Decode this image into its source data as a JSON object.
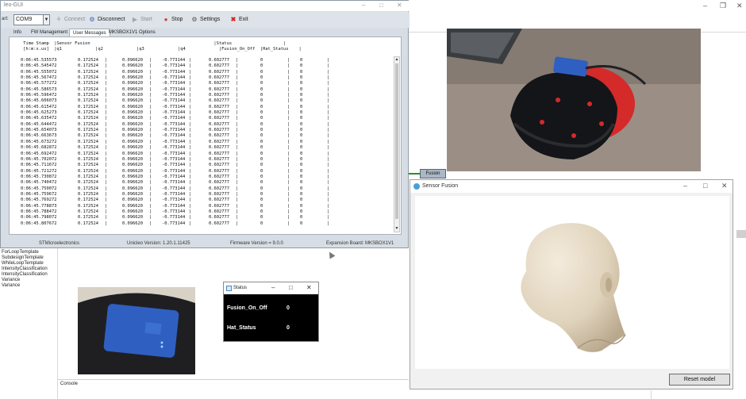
{
  "gui": {
    "title": "leo-GUI",
    "port_label": "art:",
    "port_value": "COM9",
    "toolbar": [
      {
        "label": "Connect",
        "icon": "plug-icon",
        "enabled": false
      },
      {
        "label": "Disconnect",
        "icon": "disconnect-icon",
        "enabled": true
      },
      {
        "label": "Start",
        "icon": "start-icon",
        "enabled": false
      },
      {
        "label": "Stop",
        "icon": "stop-icon",
        "enabled": true
      },
      {
        "label": "Settings",
        "icon": "gear-icon",
        "enabled": true
      },
      {
        "label": "Exit",
        "icon": "close-icon",
        "enabled": true
      }
    ],
    "tabs": [
      "Info",
      "FW Management",
      "User Messages",
      "MKSBOX1V1 Options"
    ],
    "active_tab": "User Messages",
    "table_header": " Time Stamp  |Sensor Fusion                                                |Status                    |\n [h:m:s.us]  |q1             |q2             |q3             |q4             |Fusion_On_Off  |Hat_Status    |",
    "rows": [
      [
        "0:06:45.535573",
        "0.172524",
        "0.096620",
        "-0.773144",
        "0.602777",
        "0",
        "0"
      ],
      [
        "0:06:45.545472",
        "0.172524",
        "0.096620",
        "-0.773144",
        "0.602777",
        "0",
        "0"
      ],
      [
        "0:06:45.555072",
        "0.172524",
        "0.096620",
        "-0.773144",
        "0.602777",
        "0",
        "0"
      ],
      [
        "0:06:45.567472",
        "0.172524",
        "0.096620",
        "-0.773144",
        "0.602777",
        "0",
        "0"
      ],
      [
        "0:06:45.577272",
        "0.172524",
        "0.096620",
        "-0.773144",
        "0.602777",
        "0",
        "0"
      ],
      [
        "0:06:45.586573",
        "0.172524",
        "0.096620",
        "-0.773144",
        "0.602777",
        "0",
        "0"
      ],
      [
        "0:06:45.596472",
        "0.172524",
        "0.096620",
        "-0.773144",
        "0.602777",
        "0",
        "0"
      ],
      [
        "0:06:45.606073",
        "0.172524",
        "0.096620",
        "-0.773144",
        "0.602777",
        "0",
        "0"
      ],
      [
        "0:06:45.615472",
        "0.172524",
        "0.096620",
        "-0.773144",
        "0.602777",
        "0",
        "0"
      ],
      [
        "0:06:45.625273",
        "0.172524",
        "0.096620",
        "-0.773144",
        "0.602777",
        "0",
        "0"
      ],
      [
        "0:06:45.635472",
        "0.172524",
        "0.096620",
        "-0.773144",
        "0.602777",
        "0",
        "0"
      ],
      [
        "0:06:45.644472",
        "0.172524",
        "0.096620",
        "-0.773144",
        "0.602777",
        "0",
        "0"
      ],
      [
        "0:06:45.654073",
        "0.172524",
        "0.096620",
        "-0.773144",
        "0.602777",
        "0",
        "0"
      ],
      [
        "0:06:45.663673",
        "0.172524",
        "0.096620",
        "-0.773144",
        "0.602777",
        "0",
        "0"
      ],
      [
        "0:06:45.673272",
        "0.172524",
        "0.096620",
        "-0.773144",
        "0.602777",
        "0",
        "0"
      ],
      [
        "0:06:45.682872",
        "0.172524",
        "0.096620",
        "-0.773144",
        "0.602777",
        "0",
        "0"
      ],
      [
        "0:06:45.692472",
        "0.172524",
        "0.096620",
        "-0.773144",
        "0.602777",
        "0",
        "0"
      ],
      [
        "0:06:45.702072",
        "0.172524",
        "0.096620",
        "-0.773144",
        "0.602777",
        "0",
        "0"
      ],
      [
        "0:06:45.711672",
        "0.172524",
        "0.096620",
        "-0.773144",
        "0.602777",
        "0",
        "0"
      ],
      [
        "0:06:45.721272",
        "0.172524",
        "0.096620",
        "-0.773144",
        "0.602777",
        "0",
        "0"
      ],
      [
        "0:06:45.730872",
        "0.172524",
        "0.096620",
        "-0.773144",
        "0.602777",
        "0",
        "0"
      ],
      [
        "0:06:45.740472",
        "0.172524",
        "0.096620",
        "-0.773144",
        "0.602777",
        "0",
        "0"
      ],
      [
        "0:06:45.750072",
        "0.172524",
        "0.096620",
        "-0.773144",
        "0.602777",
        "0",
        "0"
      ],
      [
        "0:06:45.759672",
        "0.172524",
        "0.096620",
        "-0.773144",
        "0.602777",
        "0",
        "0"
      ],
      [
        "0:06:45.769272",
        "0.172524",
        "0.096620",
        "-0.773144",
        "0.602777",
        "0",
        "0"
      ],
      [
        "0:06:45.778873",
        "0.172524",
        "0.096620",
        "-0.773144",
        "0.602777",
        "0",
        "0"
      ],
      [
        "0:06:45.788472",
        "0.172524",
        "0.096620",
        "-0.773144",
        "0.602777",
        "0",
        "0"
      ],
      [
        "0:06:45.798072",
        "0.172524",
        "0.096620",
        "-0.773144",
        "0.602777",
        "0",
        "0"
      ],
      [
        "0:06:45.807672",
        "0.172524",
        "0.096620",
        "-0.773144",
        "0.602777",
        "0",
        "0"
      ]
    ],
    "status_bar": {
      "company": "STMicroelectronics",
      "unicleo_version": "Unicleo Version:  1.20.1.11425",
      "firmware_version": "Firmware Version = 9.0.0",
      "expansion_board": "Expansion Board: MKSBOX1V1"
    }
  },
  "designer": {
    "tree_items": [
      "ForLoopTemplate",
      "SubdesignTemplate",
      "WhileLoopTemplate",
      "IntensityClassification",
      "IntensityClassification",
      "Variance",
      "Variance"
    ],
    "console_label": "Console",
    "fusion_node_label": "Fusion"
  },
  "status_window": {
    "title": "Status",
    "items": [
      {
        "label": "Fusion_On_Off",
        "value": "0"
      },
      {
        "label": "Hat_Status",
        "value": "0"
      }
    ]
  },
  "fusion_window": {
    "title": "Sensor Fusion",
    "reset_label": "Reset model"
  },
  "colors": {
    "hat_red": "#d42a2a",
    "device_blue": "#2f5fc1",
    "head_skin": "#e7dcc8"
  }
}
